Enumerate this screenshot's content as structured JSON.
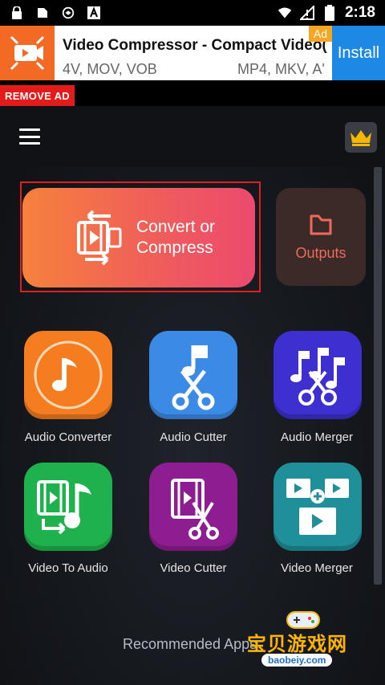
{
  "status_bar": {
    "time": "2:18",
    "icons": [
      "lock-icon",
      "sim-icon",
      "app-icon",
      "font-icon",
      "wifi-icon",
      "signal-icon",
      "battery-icon"
    ]
  },
  "ad": {
    "title": "Video Compressor - Compact Video(...",
    "subtitle_left": "4V, MOV, VOB",
    "subtitle_right": "MP4, MKV, A'",
    "badge": "Ad",
    "install_label": "Install"
  },
  "remove_ad_label": "REMOVE AD",
  "main": {
    "convert_label": "Convert or Compress",
    "outputs_label": "Outputs",
    "tools": [
      {
        "label": "Audio Converter",
        "icon": "music-note-icon",
        "color": "#f57c1f"
      },
      {
        "label": "Audio Cutter",
        "icon": "scissors-music-icon",
        "color": "#3b8be6"
      },
      {
        "label": "Audio Merger",
        "icon": "music-notes-icon",
        "color": "#3d2fd0"
      },
      {
        "label": "Video To Audio",
        "icon": "film-to-music-icon",
        "color": "#1fb14d"
      },
      {
        "label": "Video Cutter",
        "icon": "film-scissors-icon",
        "color": "#8e1d92"
      },
      {
        "label": "Video Merger",
        "icon": "film-merge-icon",
        "color": "#1f8f99"
      }
    ],
    "recommended_label": "Recommended Apps"
  },
  "watermark": {
    "title": "宝贝游戏网",
    "url": "baobeiy.com"
  },
  "colors": {
    "accent_red": "#e02020",
    "convert_gradient_start": "#f6813c",
    "convert_gradient_end": "#ec4a6e",
    "outputs_text": "#ef6a5c",
    "install_blue": "#1e88e5"
  }
}
